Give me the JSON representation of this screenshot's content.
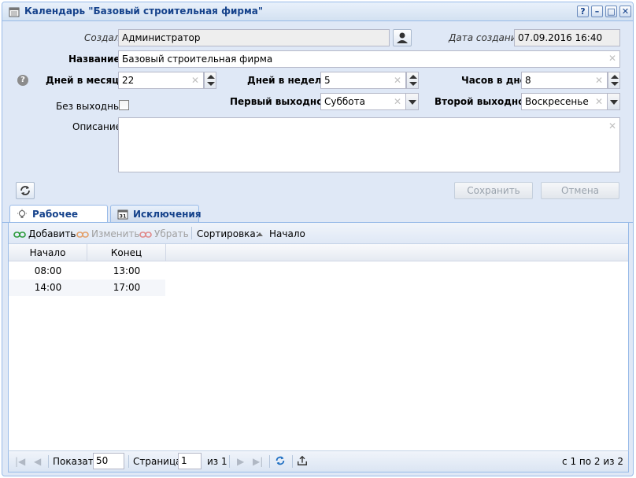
{
  "window": {
    "title": "Календарь \"Базовый строительная фирма\"",
    "buttons": {
      "help": "?",
      "minimize": "–",
      "maximize": "□",
      "close": "✕"
    }
  },
  "form": {
    "created_by_label": "Создал:",
    "created_by_value": "Администратор",
    "created_date_label": "Дата создания:",
    "created_date_value": "07.09.2016 16:40",
    "name_label": "Название:",
    "name_value": "Базовый строительная фирма",
    "days_month_label": "Дней в месяце:",
    "days_month_value": "22",
    "days_week_label": "Дней в неделе:",
    "days_week_value": "5",
    "hours_day_label": "Часов в дне:",
    "hours_day_value": "8",
    "no_weekends_label": "Без выходных:",
    "first_weekend_label": "Первый выходной:",
    "first_weekend_value": "Суббота",
    "second_weekend_label": "Второй выходной:",
    "second_weekend_value": "Воскресенье",
    "description_label": "Описание:",
    "description_value": "",
    "save_label": "Сохранить",
    "cancel_label": "Отмена"
  },
  "tabs": [
    {
      "label": "Рабочее время",
      "active": true
    },
    {
      "label": "Исключения",
      "active": false
    }
  ],
  "toolbar": {
    "add": "Добавить",
    "edit": "Изменить",
    "remove": "Убрать",
    "sort_label": "Сортировка:",
    "sort_value": "Начало"
  },
  "grid": {
    "columns": [
      "Начало",
      "Конец"
    ],
    "rows": [
      [
        "08:00",
        "13:00"
      ],
      [
        "14:00",
        "17:00"
      ]
    ]
  },
  "pager": {
    "show_label": "Показать",
    "page_size": "50",
    "page_label": "Страница",
    "page_value": "1",
    "of_label": "из 1",
    "summary": "с 1 по 2 из 2"
  },
  "colors": {
    "accent": "#15428b",
    "panel_bg": "#dfe8f6",
    "border": "#99bbe8"
  }
}
